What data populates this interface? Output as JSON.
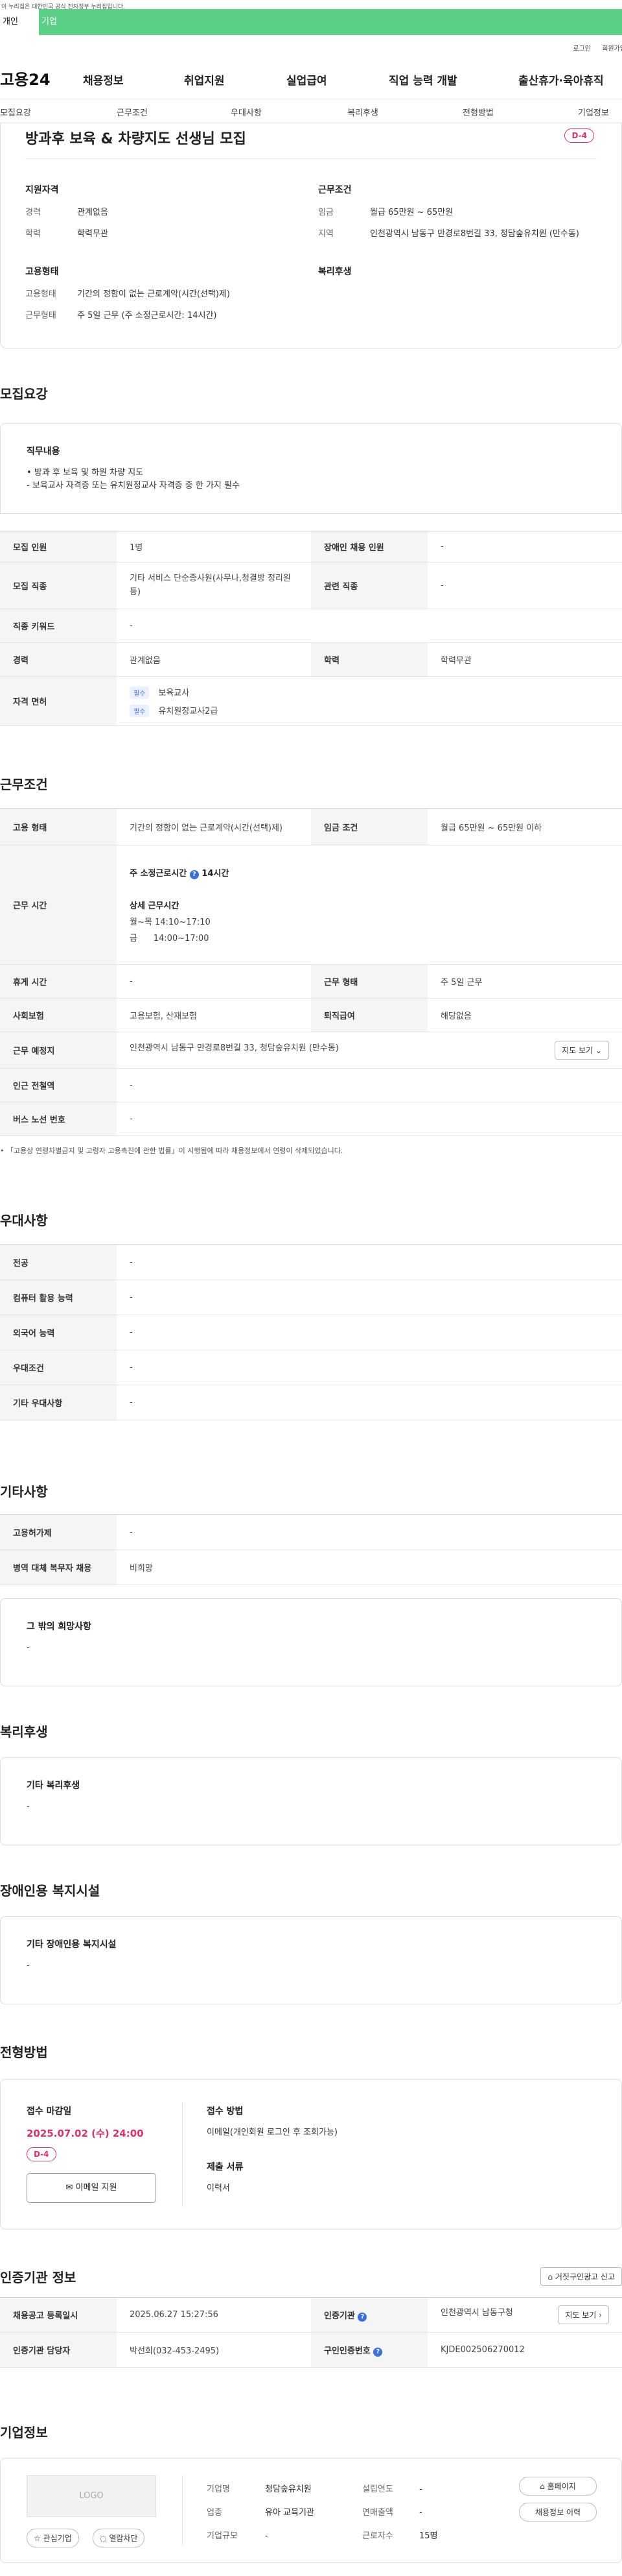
{
  "gov_notice": "이 누리집은 대한민국 공식 전자정부 누리집입니다.",
  "top_tabs": [
    "개인",
    "기업"
  ],
  "util_links": [
    "로그인",
    "회원가입"
  ],
  "brand": "고용24",
  "gnb": [
    "채용정보",
    "취업지원",
    "실업급여",
    "직업 능력 개발",
    "출산휴가·육아휴직"
  ],
  "subtabs": [
    "모집요강",
    "근무조건",
    "우대사항",
    "복리후생",
    "전형방법",
    "기업정보"
  ],
  "job_title": "방과후 보육 & 차량지도 선생님 모집",
  "dday": "D-4",
  "summary": {
    "qual_title": "지원자격",
    "qual": [
      {
        "k": "경력",
        "v": "관계없음"
      },
      {
        "k": "학력",
        "v": "학력무관"
      }
    ],
    "cond_title": "근무조건",
    "cond": [
      {
        "k": "임금",
        "v": "월급 65만원 ~ 65만원"
      },
      {
        "k": "지역",
        "v": "인천광역시 남동구 만경로8번길 33, 청담숲유치원 (만수동)"
      }
    ],
    "emp_title": "고용형태",
    "emp": [
      {
        "k": "고용형태",
        "v": "기간의 정함이 없는 근로계약(시간(선택)제)"
      },
      {
        "k": "근무형태",
        "v": "주 5일 근무 (주 소정근로시간: 14시간)"
      }
    ],
    "welfare_title": "복리후생"
  },
  "recruit": {
    "section": "모집요강",
    "duty_title": "직무내용",
    "duty_lines": [
      "• 방과 후 보육 및 하원 차량 지도",
      "- 보육교사 자격증 또는 유치원정교사 자격증 중 한 가지 필수"
    ],
    "rows": {
      "r1_h1": "모집 인원",
      "r1_v1": "1명",
      "r1_h2": "장애인 채용 인원",
      "r1_v2": "-",
      "r2_h1": "모집 직종",
      "r2_v1": "기타 서비스 단순종사원(사무나,청결방 정리원 등)",
      "r2_h2": "관련 직종",
      "r2_v2": "-",
      "r3_h1": "직종 키워드",
      "r3_v1": "-",
      "r4_h1": "경력",
      "r4_v1": "관계없음",
      "r4_h2": "학력",
      "r4_v2": "학력무관",
      "r5_h1": "자격 면허",
      "lic1_tag": "필수",
      "lic1": "보육교사",
      "lic2_tag": "필수",
      "lic2": "유치원정교사2급"
    }
  },
  "work": {
    "section": "근무조건",
    "emp_h": "고용 형태",
    "emp_v": "기간의 정함이 없는 근로계약(시간(선택)제)",
    "wage_h": "임금 조건",
    "wage_v": "월급 65만원 ~ 65만원 이하",
    "time_h": "근무 시간",
    "time_week": "주 소정근로시간",
    "time_week_v": "14시간",
    "time_detail": "상세 근무시간",
    "time_l1": "월~목 14:10~17:10",
    "time_l2": "금      14:00~17:00",
    "rest_h": "휴게 시간",
    "rest_v": "-",
    "form_h": "근무 형태",
    "form_v": "주 5일 근무",
    "ins_h": "사회보험",
    "ins_v": "고용보험, 산재보험",
    "sev_h": "퇴직급여",
    "sev_v": "해당없음",
    "place_h": "근무 예정지",
    "place_v": "인천광역시 남동구 만경로8번길 33, 청담숲유치원 (만수동)",
    "map_btn": "지도 보기",
    "subway_h": "인근 전철역",
    "subway_v": "-",
    "bus_h": "버스 노선 번호",
    "bus_v": "-",
    "notice": "「고용상 연령차별금지 및 고령자 고용촉진에 관한 법률」이 시행됨에 따라 채용정보에서 연령이 삭제되었습니다."
  },
  "pref": {
    "section": "우대사항",
    "rows": [
      {
        "h": "전공",
        "v": "-"
      },
      {
        "h": "컴퓨터 활용 능력",
        "v": "-"
      },
      {
        "h": "외국어 능력",
        "v": "-"
      },
      {
        "h": "우대조건",
        "v": "-"
      },
      {
        "h": "기타 우대사항",
        "v": "-"
      }
    ]
  },
  "etc": {
    "section": "기타사항",
    "rows": [
      {
        "h": "고용허가제",
        "v": "-"
      },
      {
        "h": "병역 대체 복무자 채용",
        "v": "비희망"
      }
    ],
    "wish_title": "그 밖의 희망사항",
    "wish_v": "-"
  },
  "welfare": {
    "section": "복리후생",
    "title": "기타 복리후생",
    "v": "-"
  },
  "disabled": {
    "section": "장애인용 복지시설",
    "title": "기타 장애인용 복지시설",
    "v": "-"
  },
  "apply": {
    "section": "전형방법",
    "deadline_h": "접수 마감일",
    "deadline_v": "2025.07.02 (수) 24:00",
    "dday": "D-4",
    "email_btn": "이메일 지원",
    "method_h": "접수 방법",
    "method_v": "이메일(개인회원 로그인 후 조회가능)",
    "docs_h": "제출 서류",
    "docs_v": "이력서"
  },
  "cert": {
    "section": "인증기관 정보",
    "report_btn": "거짓구인광고 신고",
    "reg_h": "채용공고 등록일시",
    "reg_v": "2025.06.27 15:27:56",
    "org_h": "인증기관",
    "org_v": "인천광역시 남동구청",
    "map_btn": "지도 보기",
    "mgr_h": "인증기관 담당자",
    "mgr_v": "박선희(032-453-2495)",
    "no_h": "구인인증번호",
    "no_v": "KJDE002506270012"
  },
  "company": {
    "section": "기업정보",
    "logo": "LOGO",
    "fav_btn": "관심기업",
    "block_btn": "열람차단",
    "rows": [
      {
        "k": "기업명",
        "v": "청담숲유치원",
        "k2": "설립연도",
        "v2": "-"
      },
      {
        "k": "업종",
        "v": "유아 교육기관",
        "k2": "연매출액",
        "v2": "-"
      },
      {
        "k": "기업규모",
        "v": "-",
        "k2": "근로자수",
        "v2": "15명"
      }
    ],
    "home_btn": "홈페이지",
    "history_btn": "채용정보 이력"
  }
}
